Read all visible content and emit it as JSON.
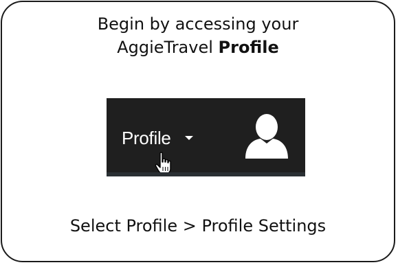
{
  "instruction": {
    "line1": "Begin by accessing your",
    "line2_prefix": "AggieTravel ",
    "line2_bold": "Profile"
  },
  "navbar": {
    "profile_label": "Profile",
    "caret_icon": "caret-down-icon",
    "avatar_icon": "user-avatar-icon",
    "cursor_icon": "hand-pointer-icon",
    "background_color": "#1f1f1f"
  },
  "footer": {
    "text": "Select Profile > Profile Settings"
  }
}
